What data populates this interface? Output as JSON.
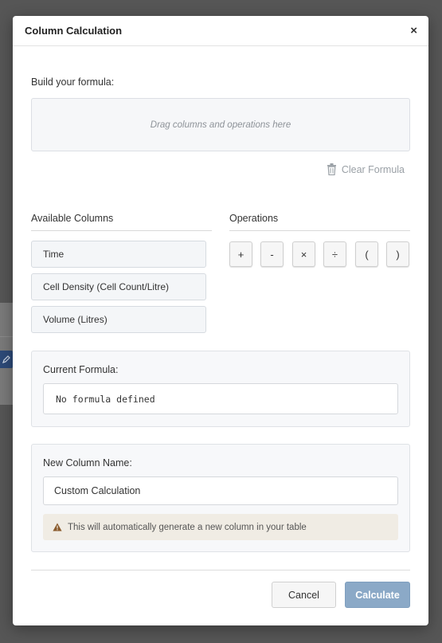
{
  "dialog": {
    "title": "Column Calculation",
    "close_label": "×"
  },
  "formula_builder": {
    "label": "Build your formula:",
    "drop_placeholder": "Drag columns and operations here",
    "clear_label": "Clear Formula"
  },
  "columns": {
    "header": "Available Columns",
    "items": [
      {
        "label": "Time"
      },
      {
        "label": "Cell Density (Cell Count/Litre)"
      },
      {
        "label": "Volume (Litres)"
      }
    ]
  },
  "operations": {
    "header": "Operations",
    "items": [
      {
        "label": "+"
      },
      {
        "label": "-"
      },
      {
        "label": "×"
      },
      {
        "label": "÷"
      },
      {
        "label": "("
      },
      {
        "label": ")"
      }
    ]
  },
  "current_formula": {
    "label": "Current Formula:",
    "value": "No formula defined"
  },
  "new_column": {
    "label": "New Column Name:",
    "value": "Custom Calculation",
    "note": "This will automatically generate a new column in your table"
  },
  "footer": {
    "cancel_label": "Cancel",
    "calculate_label": "Calculate"
  },
  "colors": {
    "primary_button": "#8ba9c7",
    "warning_icon": "#8a5a2b"
  },
  "icons": [
    "close-icon",
    "trash-icon",
    "warning-icon",
    "edit-icon"
  ]
}
